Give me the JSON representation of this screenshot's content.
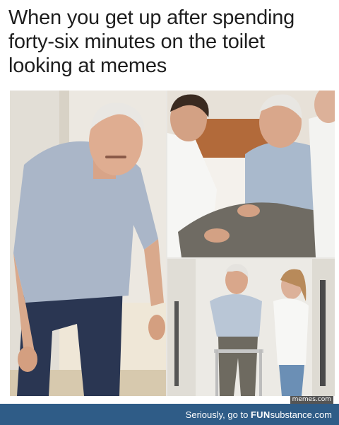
{
  "caption": "When you get up after spending forty-six minutes on the toilet looking at memes",
  "watermark": "memes.com",
  "footer": {
    "prefix": "Seriously, go to ",
    "brand_bold": "FUN",
    "brand_rest": "substance",
    "suffix": ".com",
    "background": "#2f5c87"
  },
  "panels": [
    {
      "id": "left",
      "depicts": "elderly man rising from bed"
    },
    {
      "id": "top-right",
      "depicts": "caregivers helping elderly man"
    },
    {
      "id": "bottom-right",
      "depicts": "elderly man walking with walker and nurse"
    }
  ]
}
